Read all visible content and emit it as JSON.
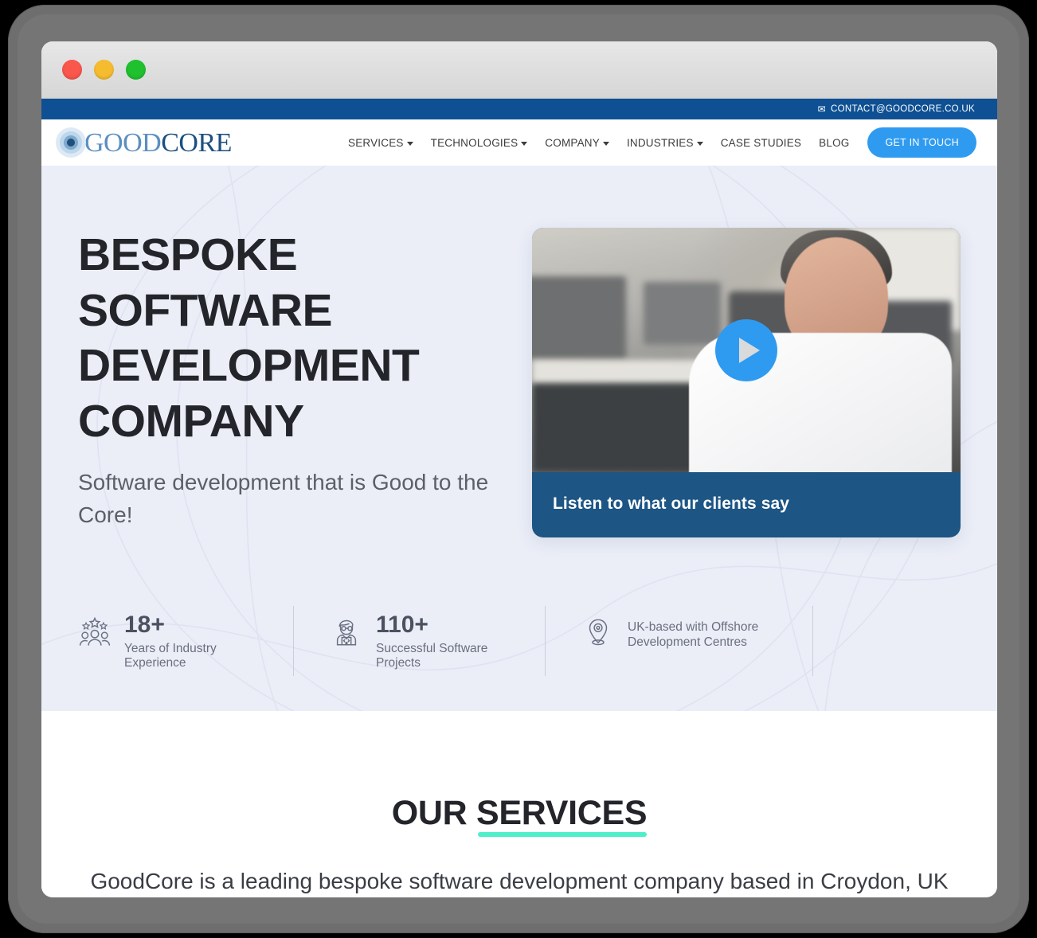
{
  "window": {
    "traffic_lights": [
      "close",
      "minimize",
      "maximize"
    ]
  },
  "topbar": {
    "email": "CONTACT@GOODCORE.CO.UK",
    "mail_icon": "envelope-icon",
    "background": "#0e5093"
  },
  "logo": {
    "part1": "GOOD",
    "part2": "CORE",
    "mark_icon": "concentric-circle-eye-icon",
    "color_part1": "#5b8fc0",
    "color_part2": "#1c4f80"
  },
  "nav": {
    "items": [
      {
        "label": "SERVICES",
        "has_dropdown": true
      },
      {
        "label": "TECHNOLOGIES",
        "has_dropdown": true
      },
      {
        "label": "COMPANY",
        "has_dropdown": true
      },
      {
        "label": "INDUSTRIES",
        "has_dropdown": true
      },
      {
        "label": "CASE STUDIES",
        "has_dropdown": false
      },
      {
        "label": "BLOG",
        "has_dropdown": false
      }
    ],
    "cta": {
      "label": "GET IN TOUCH",
      "color": "#2f9bf0"
    }
  },
  "hero": {
    "title_lines": [
      "BESPOKE",
      "SOFTWARE",
      "DEVELOPMENT",
      "COMPANY"
    ],
    "title": "BESPOKE SOFTWARE DEVELOPMENT COMPANY",
    "subtitle": "Software development that is Good to the Core!",
    "background": "#ebeef7",
    "video": {
      "caption": "Listen to what our clients say",
      "play_icon": "play-button-icon",
      "card_color": "#1d5584",
      "thumbnail_alt": "Man in white shirt seated in an open-plan office"
    },
    "stats": [
      {
        "icon": "people-with-stars-icon",
        "number": "18+",
        "label": "Years of Industry Experience"
      },
      {
        "icon": "developer-at-laptop-icon",
        "number": "110+",
        "label": "Successful Software Projects"
      },
      {
        "icon": "location-pin-icon",
        "number": "",
        "label": "UK-based with Offshore Development Centres"
      }
    ]
  },
  "services": {
    "title_plain": "OUR ",
    "title_accent": "SERVICES",
    "accent_underline_color": "#4fefca",
    "description": "GoodCore is a leading bespoke software development company based in Croydon, UK"
  }
}
